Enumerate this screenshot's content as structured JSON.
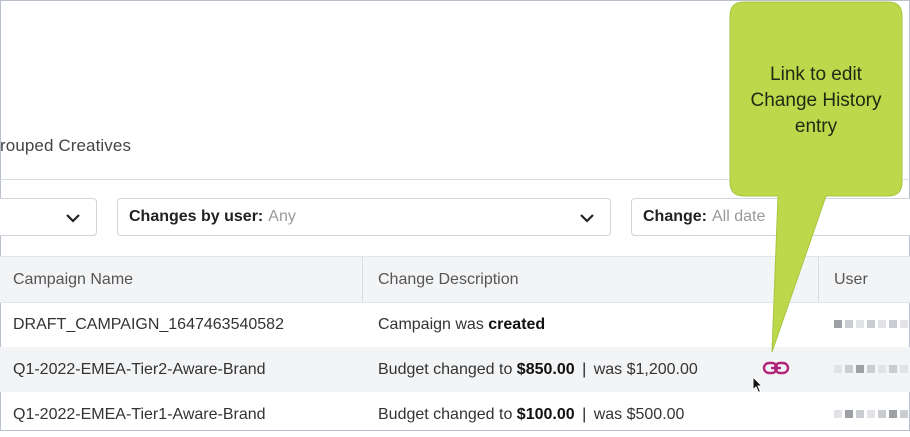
{
  "tabs": {
    "grouped_creatives_label": "rouped Creatives"
  },
  "filters": {
    "changes_by_user_label": "Changes by user:",
    "changes_by_user_value": "Any",
    "change_label": "Change:",
    "change_value": "All date"
  },
  "table": {
    "columns": [
      "Campaign Name",
      "Change Description",
      "User"
    ],
    "rows": [
      {
        "campaign": "DRAFT_CAMPAIGN_1647463540582",
        "desc_prefix": "Campaign was",
        "desc_bold": "created",
        "desc_was": ""
      },
      {
        "campaign": "Q1-2022-EMEA-Tier2-Aware-Brand",
        "desc_prefix": "Budget changed to",
        "desc_bold": "$850.00",
        "desc_was": "was $1,200.00"
      },
      {
        "campaign": "Q1-2022-EMEA-Tier1-Aware-Brand",
        "desc_prefix": "Budget changed to",
        "desc_bold": "$100.00",
        "desc_was": "was $500.00"
      }
    ]
  },
  "callout": {
    "text": "Link to edit Change History entry",
    "color": "#bdd84a"
  },
  "colors": {
    "link_icon": "#b0267a",
    "header_bg": "#f3f4f6"
  },
  "icons": {
    "edit_link": "link-icon",
    "pointer": "mouse-cursor-icon",
    "dropdown": "chevron-down-icon"
  }
}
